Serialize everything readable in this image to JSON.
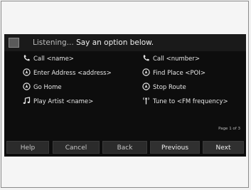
{
  "header": {
    "status": "Listening...",
    "prompt": "Say an option below."
  },
  "options": [
    {
      "label": "Call <name>",
      "icon": "phone-icon"
    },
    {
      "label": "Call <number>",
      "icon": "phone-icon"
    },
    {
      "label": "Enter Address <address>",
      "icon": "navigation-icon"
    },
    {
      "label": "Find Place <POI>",
      "icon": "navigation-icon"
    },
    {
      "label": "Go Home",
      "icon": "navigation-icon"
    },
    {
      "label": "Stop Route",
      "icon": "navigation-icon"
    },
    {
      "label": "Play Artist <name>",
      "icon": "music-note-icon"
    },
    {
      "label": "Tune to <FM frequency>",
      "icon": "radio-antenna-icon"
    }
  ],
  "page_indicator": "Page 1 of 3",
  "buttons": {
    "help": "Help",
    "cancel": "Cancel",
    "back": "Back",
    "previous": "Previous",
    "next": "Next"
  },
  "colors": {
    "screen_bg": "#0d0d0d",
    "text": "#e6e6e6",
    "button_bg": "#2b2b2b"
  }
}
